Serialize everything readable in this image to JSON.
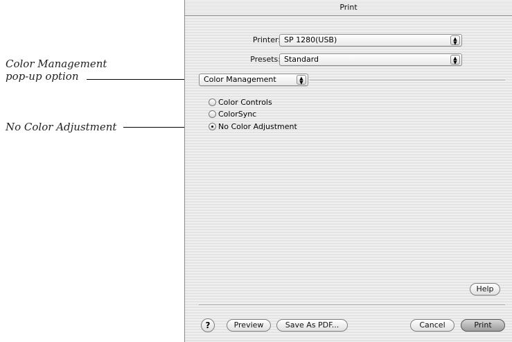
{
  "annotations": {
    "color_management_line1": "Color Management",
    "color_management_line2": "pop-up option",
    "no_color_adjustment": "No Color Adjustment"
  },
  "window": {
    "title": "Print"
  },
  "printer": {
    "label": "Printer:",
    "value": "SP 1280(USB)"
  },
  "presets": {
    "label": "Presets:",
    "value": "Standard"
  },
  "panel_popup": {
    "value": "Color Management"
  },
  "options": {
    "color_controls": "Color Controls",
    "colorsync": "ColorSync",
    "no_color_adjustment": "No Color Adjustment",
    "selected": "No Color Adjustment"
  },
  "buttons": {
    "help_label": "Help",
    "help_icon": "?",
    "preview": "Preview",
    "save_pdf": "Save As PDF...",
    "cancel": "Cancel",
    "print": "Print"
  }
}
